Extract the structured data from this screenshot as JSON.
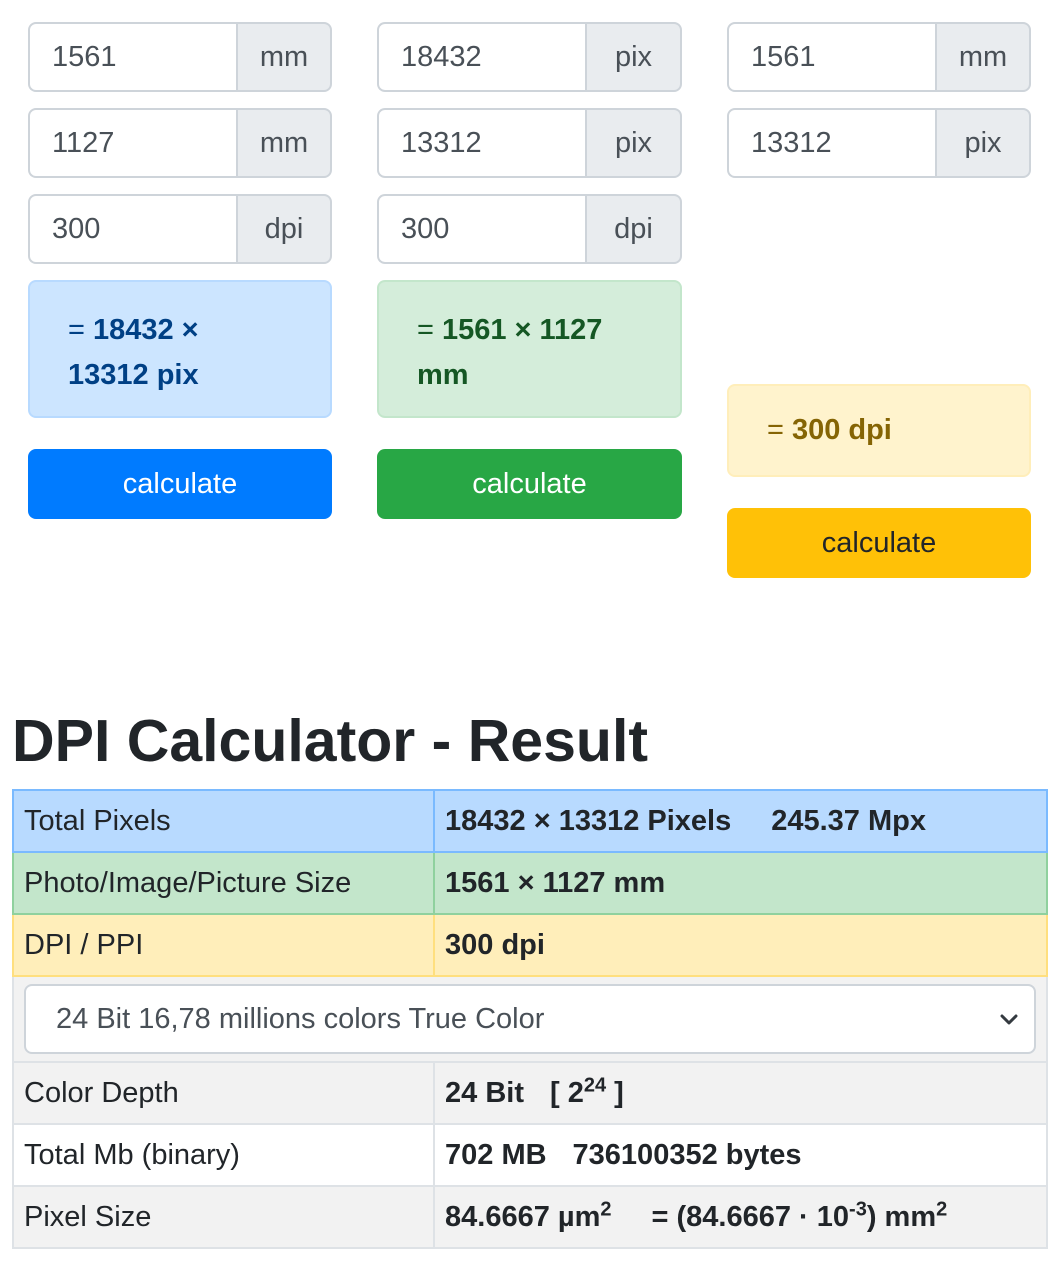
{
  "calc_pixels": {
    "width": {
      "value": "1561",
      "unit": "mm"
    },
    "height": {
      "value": "1127",
      "unit": "mm"
    },
    "dpi": {
      "value": "300",
      "unit": "dpi"
    },
    "result_eq": "=",
    "result_line1": "18432 ×",
    "result_line2": "13312 pix",
    "button": "calculate"
  },
  "calc_size": {
    "width": {
      "value": "18432",
      "unit": "pix"
    },
    "height": {
      "value": "13312",
      "unit": "pix"
    },
    "dpi": {
      "value": "300",
      "unit": "dpi"
    },
    "result_eq": "=",
    "result_line1": "1561 × 1127",
    "result_line2": "mm",
    "button": "calculate"
  },
  "calc_dpi": {
    "length": {
      "value": "1561",
      "unit": "mm"
    },
    "pixels": {
      "value": "13312",
      "unit": "pix"
    },
    "result_eq": "=",
    "result": "300 dpi",
    "button": "calculate"
  },
  "result_section": {
    "title": "DPI Calculator - Result",
    "total_pixels": {
      "label": "Total Pixels",
      "value": "18432 × 13312 Pixels",
      "mpx": "245.37 Mpx"
    },
    "image_size": {
      "label": "Photo/Image/Picture Size",
      "value": "1561 × 1127 mm"
    },
    "dpi": {
      "label": "DPI / PPI",
      "value": "300 dpi"
    },
    "color_select": {
      "selected": "24 Bit 16,78 millions colors True Color"
    },
    "color_depth": {
      "label": "Color Depth",
      "value": "24 Bit",
      "bracket_open": "[ 2",
      "exp": "24",
      "bracket_close": " ]"
    },
    "total_mb": {
      "label": "Total Mb (binary)",
      "value": "702 MB",
      "bytes": "736100352 bytes"
    },
    "pixel_size": {
      "label": "Pixel Size",
      "value": "84.6667 µm",
      "value_exp": "2",
      "eq_part": "= (84.6667 · 10",
      "eq_exp": "-3",
      "eq_tail": ") mm",
      "eq_tail_exp": "2"
    }
  },
  "colors": {
    "primary": "#007bff",
    "success": "#28a745",
    "warning": "#ffc107"
  }
}
